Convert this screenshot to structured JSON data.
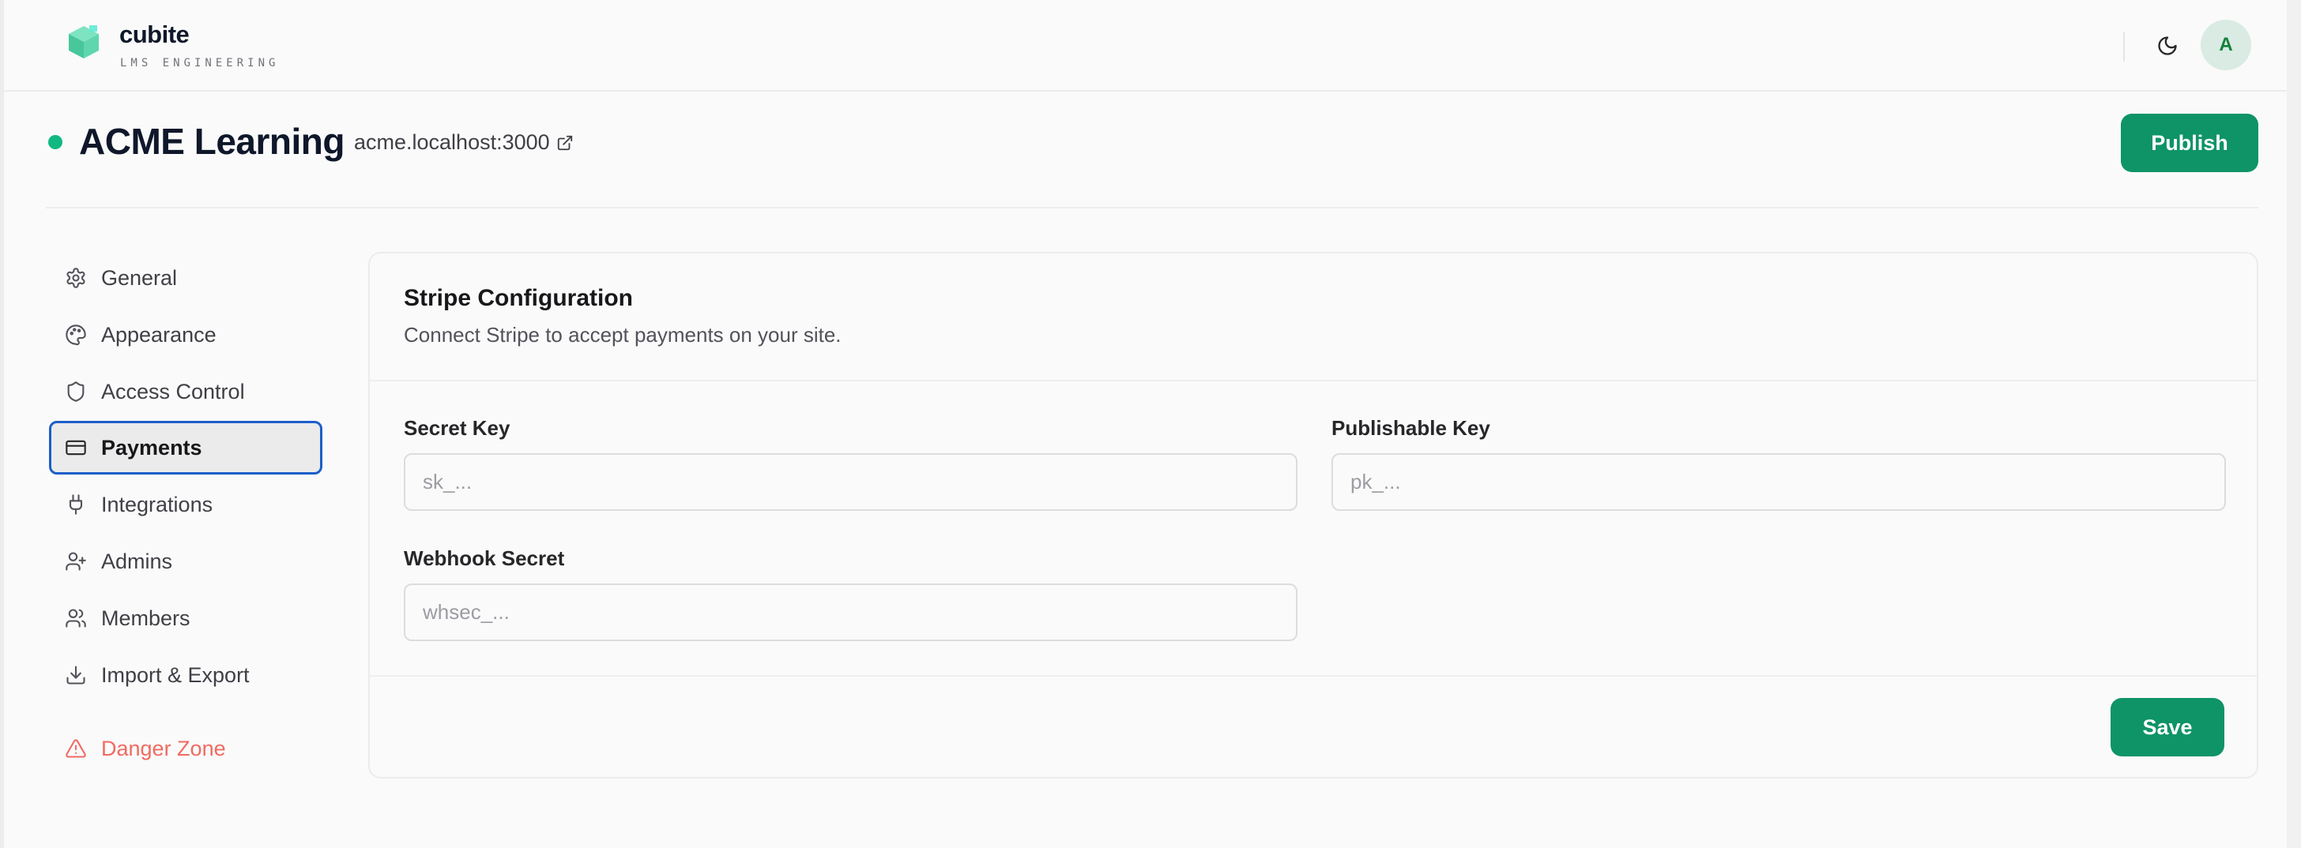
{
  "brand": {
    "name": "cubite",
    "subtitle": "LMS ENGINEERING"
  },
  "topbar": {
    "avatar_initial": "A"
  },
  "site": {
    "title": "ACME Learning",
    "url": "acme.localhost:3000",
    "publish_label": "Publish",
    "status_color": "#10b981"
  },
  "sidebar": {
    "items": [
      {
        "label": "General",
        "icon": "gear-icon"
      },
      {
        "label": "Appearance",
        "icon": "palette-icon"
      },
      {
        "label": "Access Control",
        "icon": "shield-icon"
      },
      {
        "label": "Payments",
        "icon": "credit-card-icon",
        "active": true
      },
      {
        "label": "Integrations",
        "icon": "plug-icon"
      },
      {
        "label": "Admins",
        "icon": "user-plus-icon"
      },
      {
        "label": "Members",
        "icon": "users-icon"
      },
      {
        "label": "Import & Export",
        "icon": "download-icon"
      }
    ],
    "danger": {
      "label": "Danger Zone",
      "icon": "warning-triangle-icon",
      "color": "#ef6b61"
    }
  },
  "stripe": {
    "title": "Stripe Configuration",
    "description": "Connect Stripe to accept payments on your site.",
    "secret_key": {
      "label": "Secret Key",
      "placeholder": "sk_...",
      "value": ""
    },
    "publishable_key": {
      "label": "Publishable Key",
      "placeholder": "pk_...",
      "value": ""
    },
    "webhook_secret": {
      "label": "Webhook Secret",
      "placeholder": "whsec_...",
      "value": ""
    },
    "save_label": "Save"
  },
  "colors": {
    "accent": "#0e9466",
    "active_border": "#1d5ec9"
  }
}
